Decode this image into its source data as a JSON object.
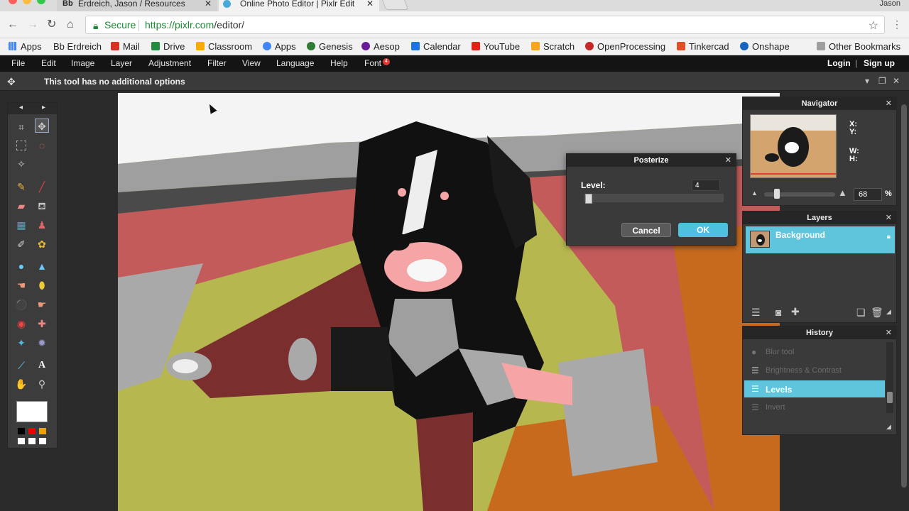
{
  "browser": {
    "tabs": [
      {
        "label": "Erdreich, Jason / Resources",
        "favicon": "Bb"
      },
      {
        "label": "Online Photo Editor | Pixlr Edit"
      }
    ],
    "user": "Jason",
    "secure_label": "Secure",
    "url_host": "https://pixlr.com",
    "url_path": "/editor/",
    "bookmarks": [
      {
        "label": "Apps",
        "color": "#4285f4"
      },
      {
        "label": "Bb Erdreich",
        "color": ""
      },
      {
        "label": "Mail",
        "color": "#d93025"
      },
      {
        "label": "Drive",
        "color": "#1e8e3e"
      },
      {
        "label": "Classroom",
        "color": "#f9ab00"
      },
      {
        "label": "Apps",
        "color": "#4285f4"
      },
      {
        "label": "Genesis",
        "color": "#2e7d32"
      },
      {
        "label": "Aesop",
        "color": "#6a1b9a"
      },
      {
        "label": "Calendar",
        "color": "#1a73e8"
      },
      {
        "label": "YouTube",
        "color": "#e62117"
      },
      {
        "label": "Scratch",
        "color": "#f7a51c"
      },
      {
        "label": "OpenProcessing",
        "color": "#c62828"
      },
      {
        "label": "Tinkercad",
        "color": "#e34c26"
      },
      {
        "label": "Onshape",
        "color": "#1565c0"
      }
    ],
    "other_bookmarks": "Other Bookmarks"
  },
  "menu": {
    "items": [
      "File",
      "Edit",
      "Image",
      "Layer",
      "Adjustment",
      "Filter",
      "View",
      "Language",
      "Help",
      "Font"
    ],
    "font_badge": "4",
    "login": "Login",
    "signup": "Sign up"
  },
  "options_bar": {
    "message": "This tool has no additional options"
  },
  "navigator": {
    "title": "Navigator",
    "x_label": "X:",
    "y_label": "Y:",
    "w_label": "W:",
    "h_label": "H:",
    "zoom": "68",
    "zoom_unit": "%"
  },
  "layers": {
    "title": "Layers",
    "items": [
      {
        "name": "Background"
      }
    ]
  },
  "history": {
    "title": "History",
    "items": [
      {
        "label": "Blur tool"
      },
      {
        "label": "Brightness & Contrast"
      },
      {
        "label": "Levels"
      },
      {
        "label": "Invert"
      }
    ]
  },
  "dialog": {
    "title": "Posterize",
    "level_label": "Level:",
    "level_value": "4",
    "cancel": "Cancel",
    "ok": "OK"
  },
  "colors": {
    "accent": "#5ec5dc",
    "ok_button": "#4fc1e0",
    "primary_color": "#ffffff"
  }
}
